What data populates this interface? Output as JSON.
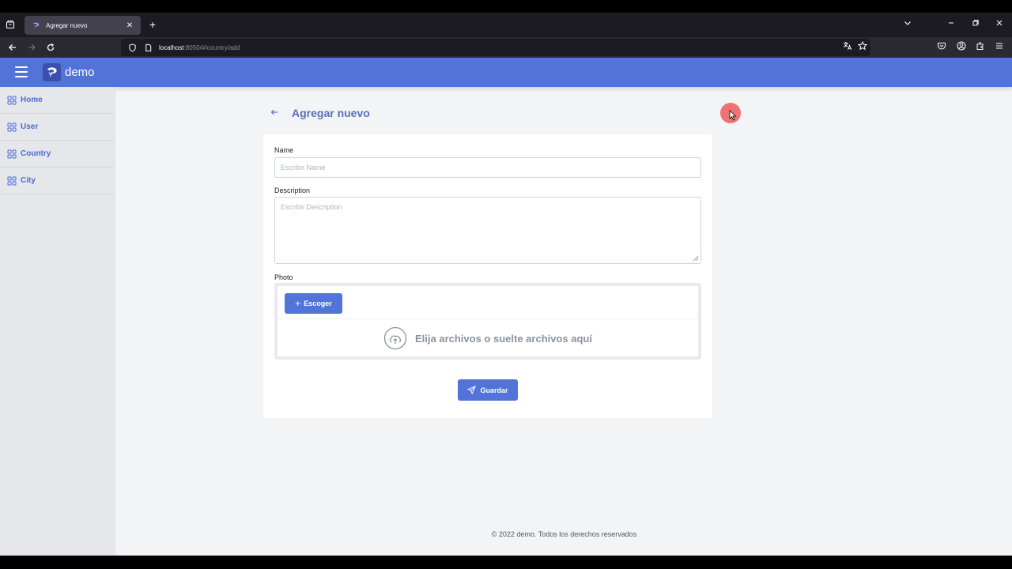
{
  "browser": {
    "tab_title": "Agregar nuevo",
    "url_host": "localhost",
    "url_rest": ":8050/#/country/add"
  },
  "app": {
    "brand": "demo"
  },
  "sidebar": {
    "items": [
      {
        "label": "Home",
        "icon": "grid-icon"
      },
      {
        "label": "User",
        "icon": "grid-icon"
      },
      {
        "label": "Country",
        "icon": "grid-icon"
      },
      {
        "label": "City",
        "icon": "grid-icon"
      }
    ]
  },
  "page": {
    "title": "Agregar nuevo"
  },
  "form": {
    "name_label": "Name",
    "name_placeholder": "Escribir Name",
    "description_label": "Description",
    "description_placeholder": "Escribir Description",
    "photo_label": "Photo",
    "choose_label": "Escoger",
    "drop_text": "Elija archivos o suelte archivos aquí",
    "save_label": "Guardar"
  },
  "footer": {
    "text": "© 2022 demo. Todos los derechos reservados"
  },
  "colors": {
    "primary": "#5274d9",
    "sidebar_bg": "#e5e7eb",
    "page_bg": "#f3f4f6"
  }
}
